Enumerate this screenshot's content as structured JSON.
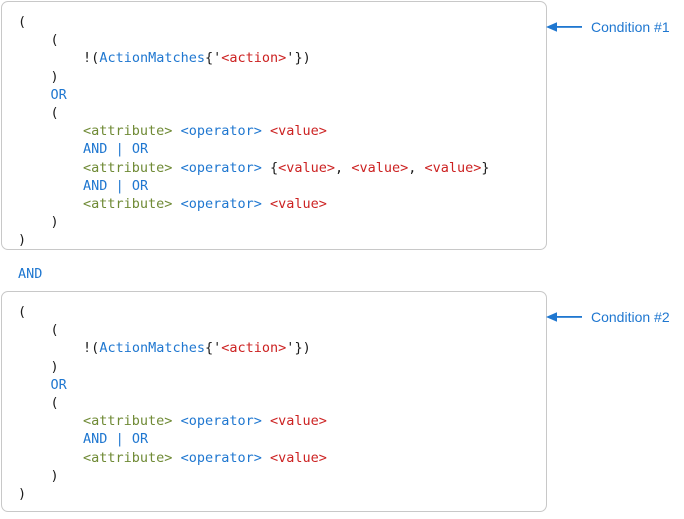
{
  "colors": {
    "accent": "#1f77d0",
    "keyword": "#1f77d0",
    "attribute": "#6f8a35",
    "operator": "#1f77d0",
    "value": "#cc2222",
    "punctuation": "#1a1a1a",
    "box_border": "#c8c8c8",
    "background": "#ffffff"
  },
  "connector": {
    "label": "AND"
  },
  "callouts": [
    {
      "label": "Condition #1",
      "icon": "left-arrow-icon"
    },
    {
      "label": "Condition #2",
      "icon": "left-arrow-icon"
    }
  ],
  "conditions": [
    {
      "name": "Condition #1",
      "lines": [
        {
          "indent": 0,
          "tokens": [
            {
              "text": "(",
              "type": "punct"
            }
          ]
        },
        {
          "indent": 1,
          "tokens": [
            {
              "text": "(",
              "type": "punct"
            }
          ]
        },
        {
          "indent": 2,
          "tokens": [
            {
              "text": "!",
              "type": "bang"
            },
            {
              "text": "(",
              "type": "punct"
            },
            {
              "text": "ActionMatches",
              "type": "fn"
            },
            {
              "text": "{",
              "type": "brace"
            },
            {
              "text": "'",
              "type": "quote"
            },
            {
              "text": "<action>",
              "type": "val"
            },
            {
              "text": "'",
              "type": "quote"
            },
            {
              "text": "}",
              "type": "brace"
            },
            {
              "text": ")",
              "type": "punct"
            }
          ]
        },
        {
          "indent": 1,
          "tokens": [
            {
              "text": ")",
              "type": "punct"
            }
          ]
        },
        {
          "indent": 1,
          "tokens": [
            {
              "text": "OR",
              "type": "kw"
            }
          ]
        },
        {
          "indent": 1,
          "tokens": [
            {
              "text": "(",
              "type": "punct"
            }
          ]
        },
        {
          "indent": 2,
          "tokens": [
            {
              "text": "<attribute>",
              "type": "attr"
            },
            {
              "text": " ",
              "type": "punct"
            },
            {
              "text": "<operator>",
              "type": "op"
            },
            {
              "text": " ",
              "type": "punct"
            },
            {
              "text": "<value>",
              "type": "val"
            }
          ]
        },
        {
          "indent": 2,
          "tokens": [
            {
              "text": "AND",
              "type": "kw"
            },
            {
              "text": " ",
              "type": "punct"
            },
            {
              "text": "|",
              "type": "kw"
            },
            {
              "text": " ",
              "type": "punct"
            },
            {
              "text": "OR",
              "type": "kw"
            }
          ]
        },
        {
          "indent": 2,
          "tokens": [
            {
              "text": "<attribute>",
              "type": "attr"
            },
            {
              "text": " ",
              "type": "punct"
            },
            {
              "text": "<operator>",
              "type": "op"
            },
            {
              "text": " ",
              "type": "punct"
            },
            {
              "text": "{",
              "type": "brace"
            },
            {
              "text": "<value>",
              "type": "val"
            },
            {
              "text": ", ",
              "type": "punct"
            },
            {
              "text": "<value>",
              "type": "val"
            },
            {
              "text": ", ",
              "type": "punct"
            },
            {
              "text": "<value>",
              "type": "val"
            },
            {
              "text": "}",
              "type": "brace"
            }
          ]
        },
        {
          "indent": 2,
          "tokens": [
            {
              "text": "AND",
              "type": "kw"
            },
            {
              "text": " ",
              "type": "punct"
            },
            {
              "text": "|",
              "type": "kw"
            },
            {
              "text": " ",
              "type": "punct"
            },
            {
              "text": "OR",
              "type": "kw"
            }
          ]
        },
        {
          "indent": 2,
          "tokens": [
            {
              "text": "<attribute>",
              "type": "attr"
            },
            {
              "text": " ",
              "type": "punct"
            },
            {
              "text": "<operator>",
              "type": "op"
            },
            {
              "text": " ",
              "type": "punct"
            },
            {
              "text": "<value>",
              "type": "val"
            }
          ]
        },
        {
          "indent": 1,
          "tokens": [
            {
              "text": ")",
              "type": "punct"
            }
          ]
        },
        {
          "indent": 0,
          "tokens": [
            {
              "text": ")",
              "type": "punct"
            }
          ]
        }
      ]
    },
    {
      "name": "Condition #2",
      "lines": [
        {
          "indent": 0,
          "tokens": [
            {
              "text": "(",
              "type": "punct"
            }
          ]
        },
        {
          "indent": 1,
          "tokens": [
            {
              "text": "(",
              "type": "punct"
            }
          ]
        },
        {
          "indent": 2,
          "tokens": [
            {
              "text": "!",
              "type": "bang"
            },
            {
              "text": "(",
              "type": "punct"
            },
            {
              "text": "ActionMatches",
              "type": "fn"
            },
            {
              "text": "{",
              "type": "brace"
            },
            {
              "text": "'",
              "type": "quote"
            },
            {
              "text": "<action>",
              "type": "val"
            },
            {
              "text": "'",
              "type": "quote"
            },
            {
              "text": "}",
              "type": "brace"
            },
            {
              "text": ")",
              "type": "punct"
            }
          ]
        },
        {
          "indent": 1,
          "tokens": [
            {
              "text": ")",
              "type": "punct"
            }
          ]
        },
        {
          "indent": 1,
          "tokens": [
            {
              "text": "OR",
              "type": "kw"
            }
          ]
        },
        {
          "indent": 1,
          "tokens": [
            {
              "text": "(",
              "type": "punct"
            }
          ]
        },
        {
          "indent": 2,
          "tokens": [
            {
              "text": "<attribute>",
              "type": "attr"
            },
            {
              "text": " ",
              "type": "punct"
            },
            {
              "text": "<operator>",
              "type": "op"
            },
            {
              "text": " ",
              "type": "punct"
            },
            {
              "text": "<value>",
              "type": "val"
            }
          ]
        },
        {
          "indent": 2,
          "tokens": [
            {
              "text": "AND",
              "type": "kw"
            },
            {
              "text": " ",
              "type": "punct"
            },
            {
              "text": "|",
              "type": "kw"
            },
            {
              "text": " ",
              "type": "punct"
            },
            {
              "text": "OR",
              "type": "kw"
            }
          ]
        },
        {
          "indent": 2,
          "tokens": [
            {
              "text": "<attribute>",
              "type": "attr"
            },
            {
              "text": " ",
              "type": "punct"
            },
            {
              "text": "<operator>",
              "type": "op"
            },
            {
              "text": " ",
              "type": "punct"
            },
            {
              "text": "<value>",
              "type": "val"
            }
          ]
        },
        {
          "indent": 1,
          "tokens": [
            {
              "text": ")",
              "type": "punct"
            }
          ]
        },
        {
          "indent": 0,
          "tokens": [
            {
              "text": ")",
              "type": "punct"
            }
          ]
        }
      ]
    }
  ]
}
